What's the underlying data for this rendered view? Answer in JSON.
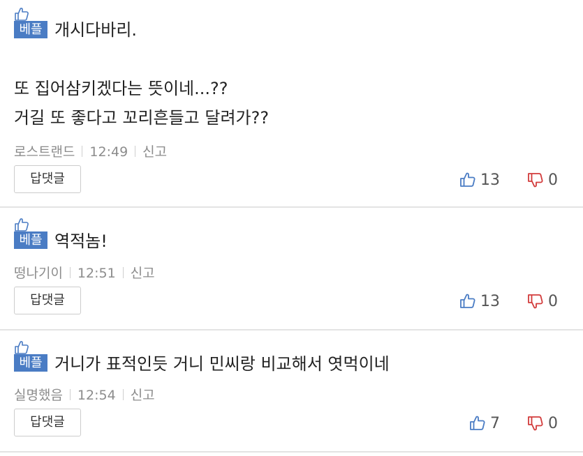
{
  "comments": [
    {
      "badge": "베플",
      "text_lines": [
        "개시다바리.",
        "",
        "또 집어삼키겠다는 뜻이네...??",
        "거길 또 좋다고 꼬리흔들고 달려가??"
      ],
      "author": "로스트랜드",
      "time": "12:49",
      "report": "신고",
      "reply": "답댓글",
      "likes": "13",
      "dislikes": "0"
    },
    {
      "badge": "베플",
      "text_lines": [
        "역적놈!"
      ],
      "author": "떵나기이",
      "time": "12:51",
      "report": "신고",
      "reply": "답댓글",
      "likes": "13",
      "dislikes": "0"
    },
    {
      "badge": "베플",
      "text_lines": [
        "거니가 표적인듯 거니 민씨랑 비교해서 엿먹이네"
      ],
      "author": "실명했음",
      "time": "12:54",
      "report": "신고",
      "reply": "답댓글",
      "likes": "7",
      "dislikes": "0"
    }
  ],
  "colors": {
    "badge": "#4a7cc4",
    "like_icon": "#4a7cc4",
    "dislike_icon": "#d23b3b",
    "divider": "#e3e3e3"
  },
  "icons": {
    "badge": "thumbs-up-outline-icon",
    "like": "thumbs-up-icon",
    "dislike": "thumbs-down-icon"
  }
}
